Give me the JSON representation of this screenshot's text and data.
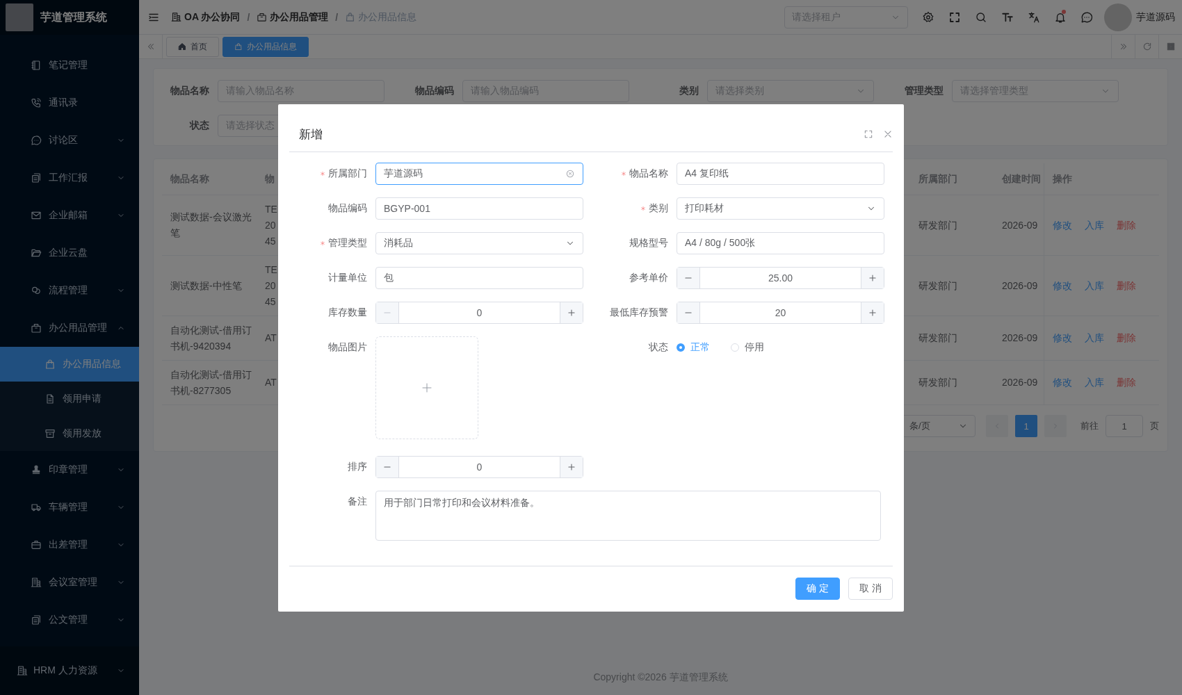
{
  "sidebar": {
    "logo_title": "芋道管理系统",
    "items": [
      {
        "label": "笔记管理"
      },
      {
        "label": "通讯录"
      },
      {
        "label": "讨论区",
        "expanded": false
      },
      {
        "label": "工作汇报",
        "expanded": false
      },
      {
        "label": "企业邮箱",
        "expanded": false
      },
      {
        "label": "企业云盘"
      },
      {
        "label": "流程管理",
        "expanded": false
      },
      {
        "label": "办公用品管理",
        "expanded": true,
        "children": [
          {
            "label": "办公用品信息",
            "selected": true
          },
          {
            "label": "领用申请",
            "selected": false
          },
          {
            "label": "领用发放",
            "selected": false
          }
        ]
      },
      {
        "label": "印章管理",
        "expanded": false
      },
      {
        "label": "车辆管理",
        "expanded": false
      },
      {
        "label": "出差管理",
        "expanded": false
      },
      {
        "label": "会议室管理",
        "expanded": false
      },
      {
        "label": "公文管理",
        "expanded": false
      }
    ],
    "bottom_item": {
      "label": "HRM 人力资源",
      "expanded": false
    }
  },
  "header": {
    "breadcrumb": [
      {
        "label": "OA 办公协同",
        "current": false
      },
      {
        "label": "办公用品管理",
        "current": false
      },
      {
        "label": "办公用品信息",
        "current": true
      }
    ],
    "separator": "/",
    "tenant_select": {
      "placeholder": "请选择租户"
    },
    "has_unread": true,
    "user_name": "芋道源码"
  },
  "tabs": [
    {
      "label": "首页",
      "selected": false
    },
    {
      "label": "办公用品信息",
      "selected": true
    }
  ],
  "filter": [
    {
      "label": "物品名称",
      "kind": "input",
      "placeholder": "请输入物品名称"
    },
    {
      "label": "物品编码",
      "kind": "input",
      "placeholder": "请输入物品编码"
    },
    {
      "label": "类别",
      "kind": "select",
      "placeholder": "请选择类别"
    },
    {
      "label": "管理类型",
      "kind": "select",
      "placeholder": "请选择管理类型"
    },
    {
      "label": "状态",
      "kind": "select",
      "placeholder": "请选择状态"
    }
  ],
  "table": {
    "columns": [
      "物品名称",
      "物",
      "所属部门",
      "创建时间",
      "操作"
    ],
    "rows": [
      {
        "item_name": "测试数据-会议激光笔",
        "column_2": [
          "TE",
          "20",
          "45"
        ],
        "department": "研发部门",
        "created_at": "2026-09",
        "actions": [
          {
            "label": "修改",
            "kind": "link"
          },
          {
            "label": "入库",
            "kind": "link"
          },
          {
            "label": "删除",
            "kind": "danger"
          }
        ]
      },
      {
        "item_name": "测试数据-中性笔",
        "column_2": [
          "TE",
          "20",
          "45"
        ],
        "department": "研发部门",
        "created_at": "2026-09",
        "actions": [
          {
            "label": "修改",
            "kind": "link"
          },
          {
            "label": "入库",
            "kind": "link"
          },
          {
            "label": "删除",
            "kind": "danger"
          }
        ]
      },
      {
        "item_name": "自动化测试-借用订书机-9420394",
        "column_2": [
          "AT"
        ],
        "department": "研发部门",
        "created_at": "2026-09",
        "actions": [
          {
            "label": "修改",
            "kind": "link"
          },
          {
            "label": "入库",
            "kind": "link"
          },
          {
            "label": "删除",
            "kind": "danger"
          }
        ]
      },
      {
        "item_name": "自动化测试-借用订书机-8277305",
        "column_2": [
          "AT"
        ],
        "department": "研发部门",
        "created_at": "2026-09",
        "actions": [
          {
            "label": "修改",
            "kind": "link"
          },
          {
            "label": "入库",
            "kind": "link"
          },
          {
            "label": "删除",
            "kind": "danger"
          }
        ]
      }
    ],
    "pagination": {
      "page_size": "条/页",
      "prev_disabled": true,
      "next_disabled": true,
      "pages": [
        {
          "label": "1",
          "selected": true
        }
      ],
      "goto_label": "前往",
      "goto_value": "1",
      "page_suffix": "页"
    }
  },
  "dialog": {
    "title": "新增",
    "fields": [
      {
        "label": "所属部门",
        "required": true,
        "kind": "select",
        "value": "芋道源码",
        "focused": true,
        "clearable": true
      },
      {
        "label": "物品名称",
        "required": true,
        "kind": "text",
        "value": "A4 复印纸"
      },
      {
        "label": "物品编码",
        "required": false,
        "kind": "text",
        "value": "BGYP-001"
      },
      {
        "label": "类别",
        "required": true,
        "kind": "select",
        "value": "打印耗材",
        "focused": false,
        "clearable": false
      },
      {
        "label": "管理类型",
        "required": true,
        "kind": "select",
        "value": "消耗品",
        "focused": false,
        "clearable": false
      },
      {
        "label": "规格型号",
        "required": false,
        "kind": "text",
        "value": "A4 / 80g / 500张"
      },
      {
        "label": "计量单位",
        "required": false,
        "kind": "text",
        "value": "包"
      },
      {
        "label": "参考单价",
        "required": false,
        "kind": "number",
        "value": "25.00",
        "decrease_disabled": false
      },
      {
        "label": "库存数量",
        "required": false,
        "kind": "number",
        "value": "0",
        "decrease_disabled": true
      },
      {
        "label": "最低库存预警",
        "required": false,
        "kind": "number",
        "value": "20",
        "decrease_disabled": false
      },
      {
        "label": "物品图片",
        "required": false,
        "kind": "upload"
      },
      {
        "label": "状态",
        "required": false,
        "kind": "radio",
        "options": [
          {
            "label": "正常",
            "selected": true
          },
          {
            "label": "停用",
            "selected": false
          }
        ]
      },
      {
        "label": "排序",
        "required": false,
        "kind": "number",
        "value": "0",
        "decrease_disabled": false
      },
      {
        "label": "备注",
        "required": false,
        "kind": "textarea",
        "value": "用于部门日常打印和会议材料准备。"
      }
    ],
    "buttons": [
      {
        "label": "确 定",
        "kind": "primary"
      },
      {
        "label": "取 消",
        "kind": "default"
      }
    ]
  },
  "footer": {
    "copyright": "Copyright ©2026 芋道管理系统"
  }
}
